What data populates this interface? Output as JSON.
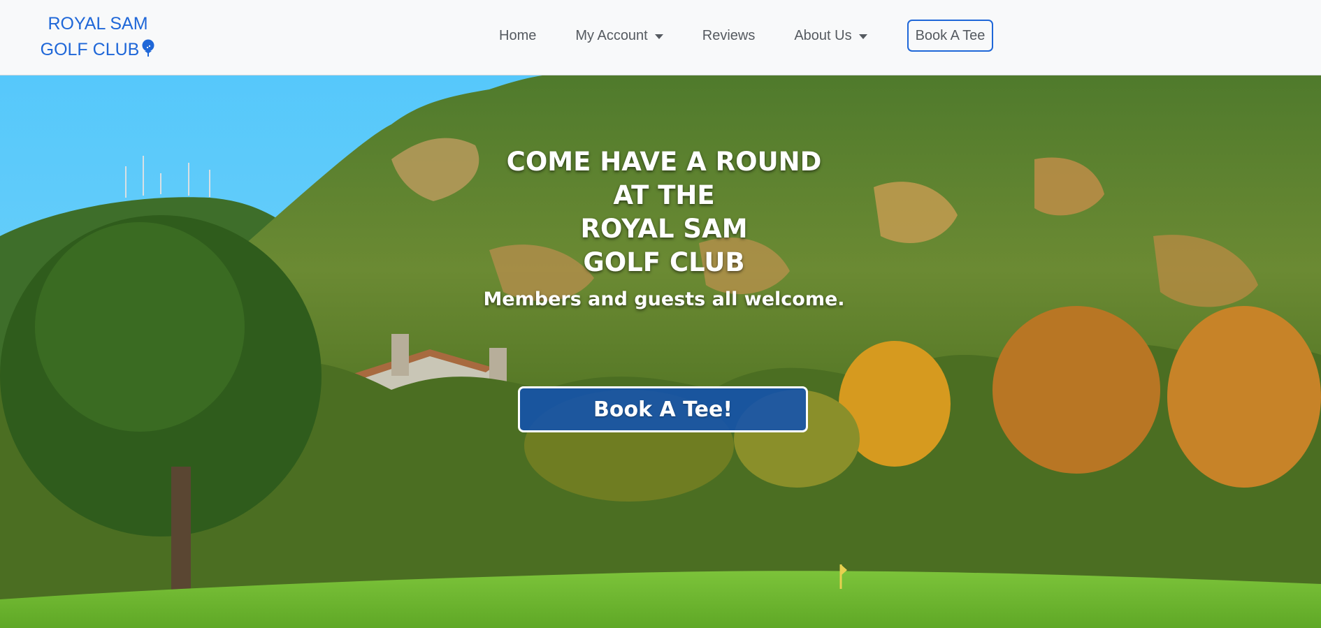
{
  "brand": {
    "line1": "ROYAL SAM",
    "line2": "GOLF CLUB",
    "icon": "golf-tee-icon",
    "color": "#1f67d8"
  },
  "nav": {
    "items": [
      {
        "label": "Home",
        "dropdown": false
      },
      {
        "label": "My Account",
        "dropdown": true
      },
      {
        "label": "Reviews",
        "dropdown": false
      },
      {
        "label": "About Us",
        "dropdown": true
      }
    ],
    "cta_label": "Book A Tee"
  },
  "hero": {
    "title_lines": [
      "COME HAVE A ROUND",
      "AT THE",
      "ROYAL SAM",
      "GOLF CLUB"
    ],
    "subtitle": "Members and guests all welcome.",
    "button_label": "Book A Tee!"
  },
  "colors": {
    "accent": "#1f67d8",
    "navbar_bg": "#f8f9fa",
    "nav_text": "#555a60",
    "hero_button_bg": "#1252af"
  }
}
